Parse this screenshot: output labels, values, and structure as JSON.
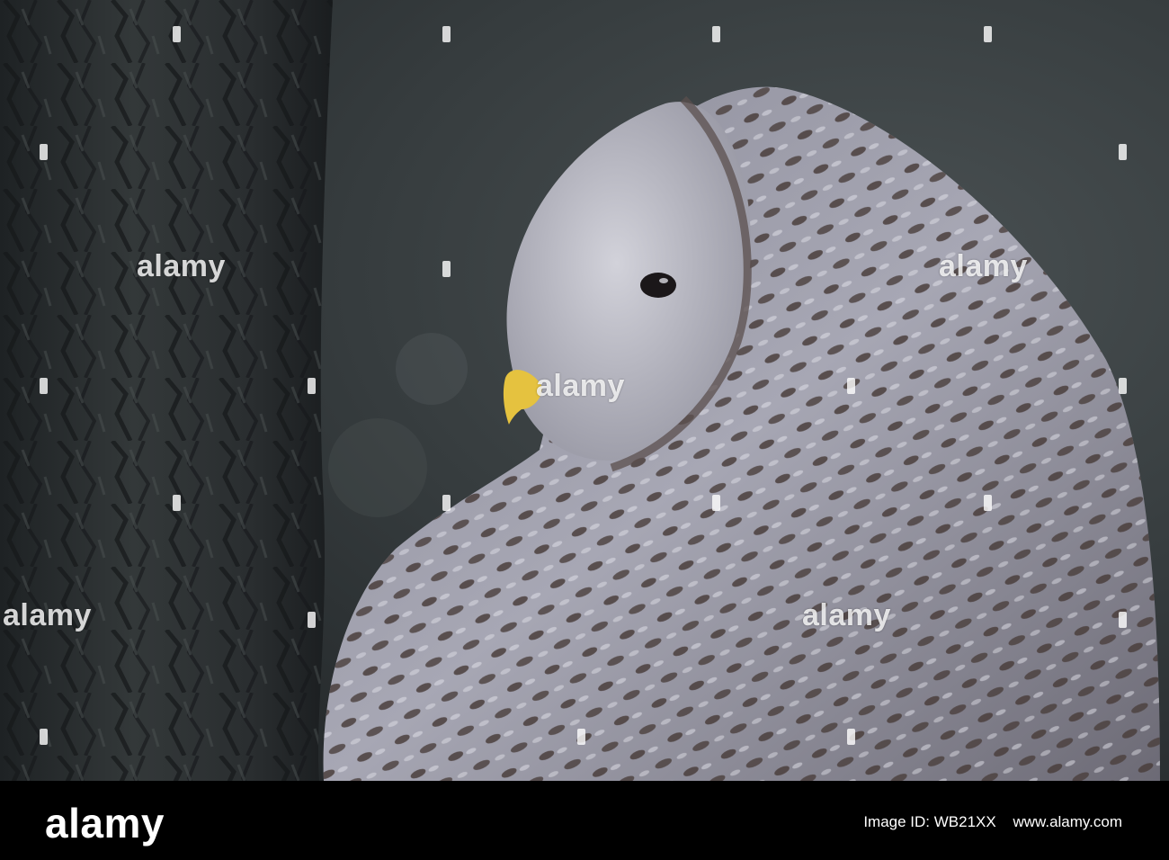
{
  "photo": {
    "subject": "owl-against-tree-trunk",
    "colors": {
      "bark": "#2f3335",
      "background": "#3b4244",
      "feather_light": "#c9c9d3",
      "feather_dark": "#4a3e3c",
      "beak": "#e5c23f"
    }
  },
  "watermark": {
    "text": "alamy"
  },
  "footer": {
    "logo": "alamy",
    "line1": "www.alamy.com",
    "line2": "Image ID: WB21XX"
  }
}
